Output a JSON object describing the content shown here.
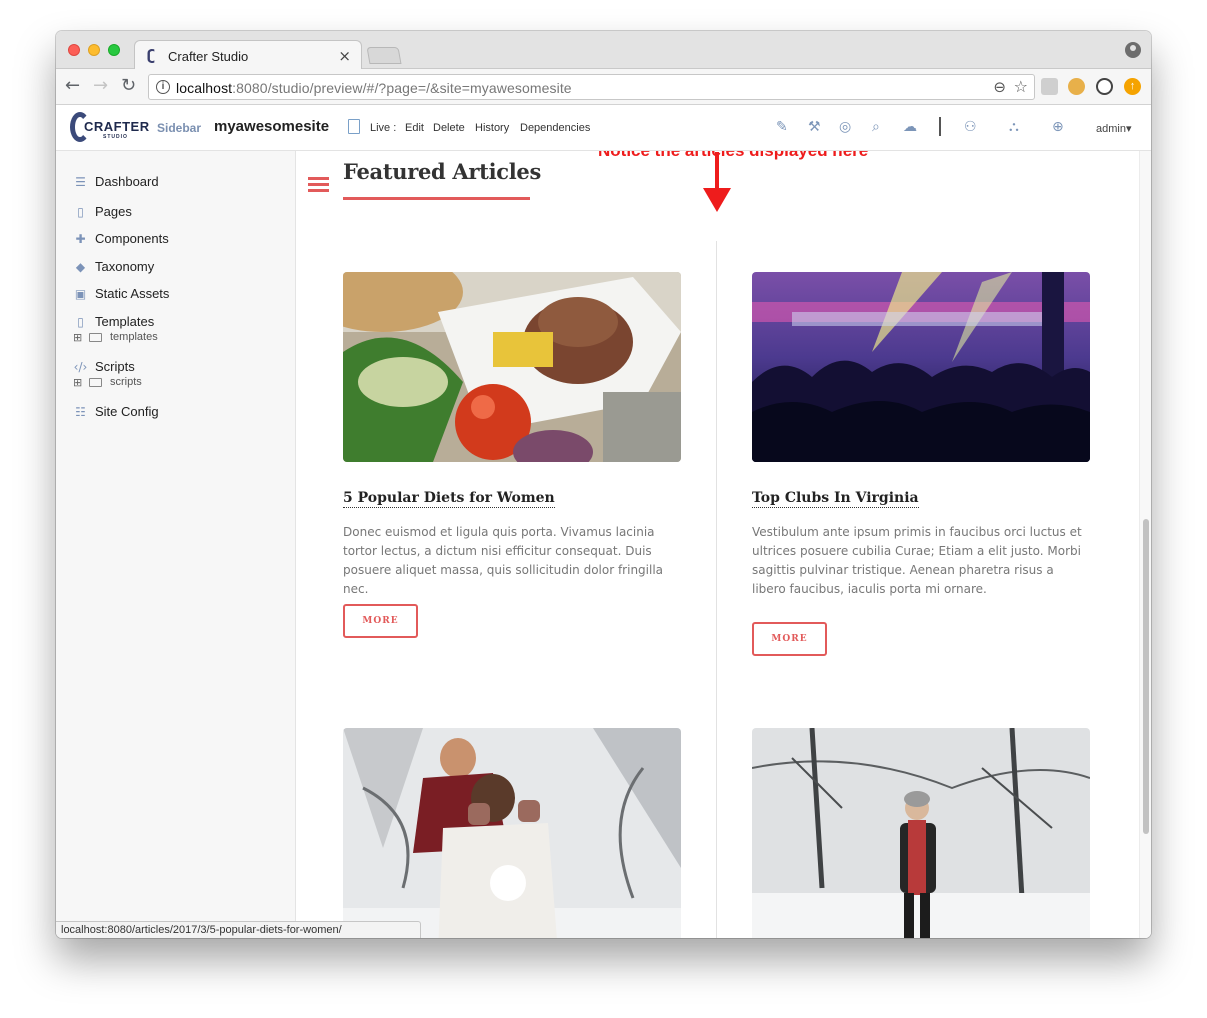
{
  "browser": {
    "tab_title": "Crafter Studio",
    "tab_close": "×",
    "url_host": "localhost",
    "url_rest": ":8080/studio/preview/#/?page=/&site=myawesomesite",
    "status_url": "localhost:8080/articles/2017/3/5-popular-diets-for-women/"
  },
  "toolbar": {
    "logo_text": "CRAFTER",
    "logo_sub": "STUDIO",
    "sidebar_label": "Sidebar",
    "site_name": "myawesomesite",
    "live_label": "Live :",
    "actions": [
      "Edit",
      "Delete",
      "History",
      "Dependencies"
    ],
    "admin_label": "admin▾"
  },
  "sidebar": {
    "items": [
      {
        "label": "Dashboard",
        "icon": "dashboard-icon"
      },
      {
        "label": "Pages",
        "icon": "pages-icon"
      },
      {
        "label": "Components",
        "icon": "components-icon"
      },
      {
        "label": "Taxonomy",
        "icon": "taxonomy-icon"
      },
      {
        "label": "Static Assets",
        "icon": "static-assets-icon"
      },
      {
        "label": "Templates",
        "icon": "templates-icon",
        "sub": "templates"
      },
      {
        "label": "Scripts",
        "icon": "scripts-icon",
        "sub": "scripts"
      },
      {
        "label": "Site Config",
        "icon": "site-config-icon"
      }
    ]
  },
  "content": {
    "section_title": "Featured Articles",
    "annotation": "Notice the articles displayed here",
    "more_label": "MORE",
    "articles": [
      {
        "title": "5 Popular Diets for Women",
        "body": "Donec euismod et ligula quis porta. Vivamus lacinia tortor lectus, a dictum nisi efficitur consequat. Duis posuere aliquet massa, quis sollicitudin dolor fringilla nec."
      },
      {
        "title": "Top Clubs In Virginia",
        "body": "Vestibulum ante ipsum primis in faucibus orci luctus et ultrices posuere cubilia Curae; Etiam a elit justo. Morbi sagittis pulvinar tristique. Aenean pharetra risus a libero faucibus, iaculis porta mi ornare."
      }
    ]
  },
  "colors": {
    "accent": "#e25a5a",
    "annotation": "#ee1c1c",
    "icon_blue": "#7c95b8"
  }
}
